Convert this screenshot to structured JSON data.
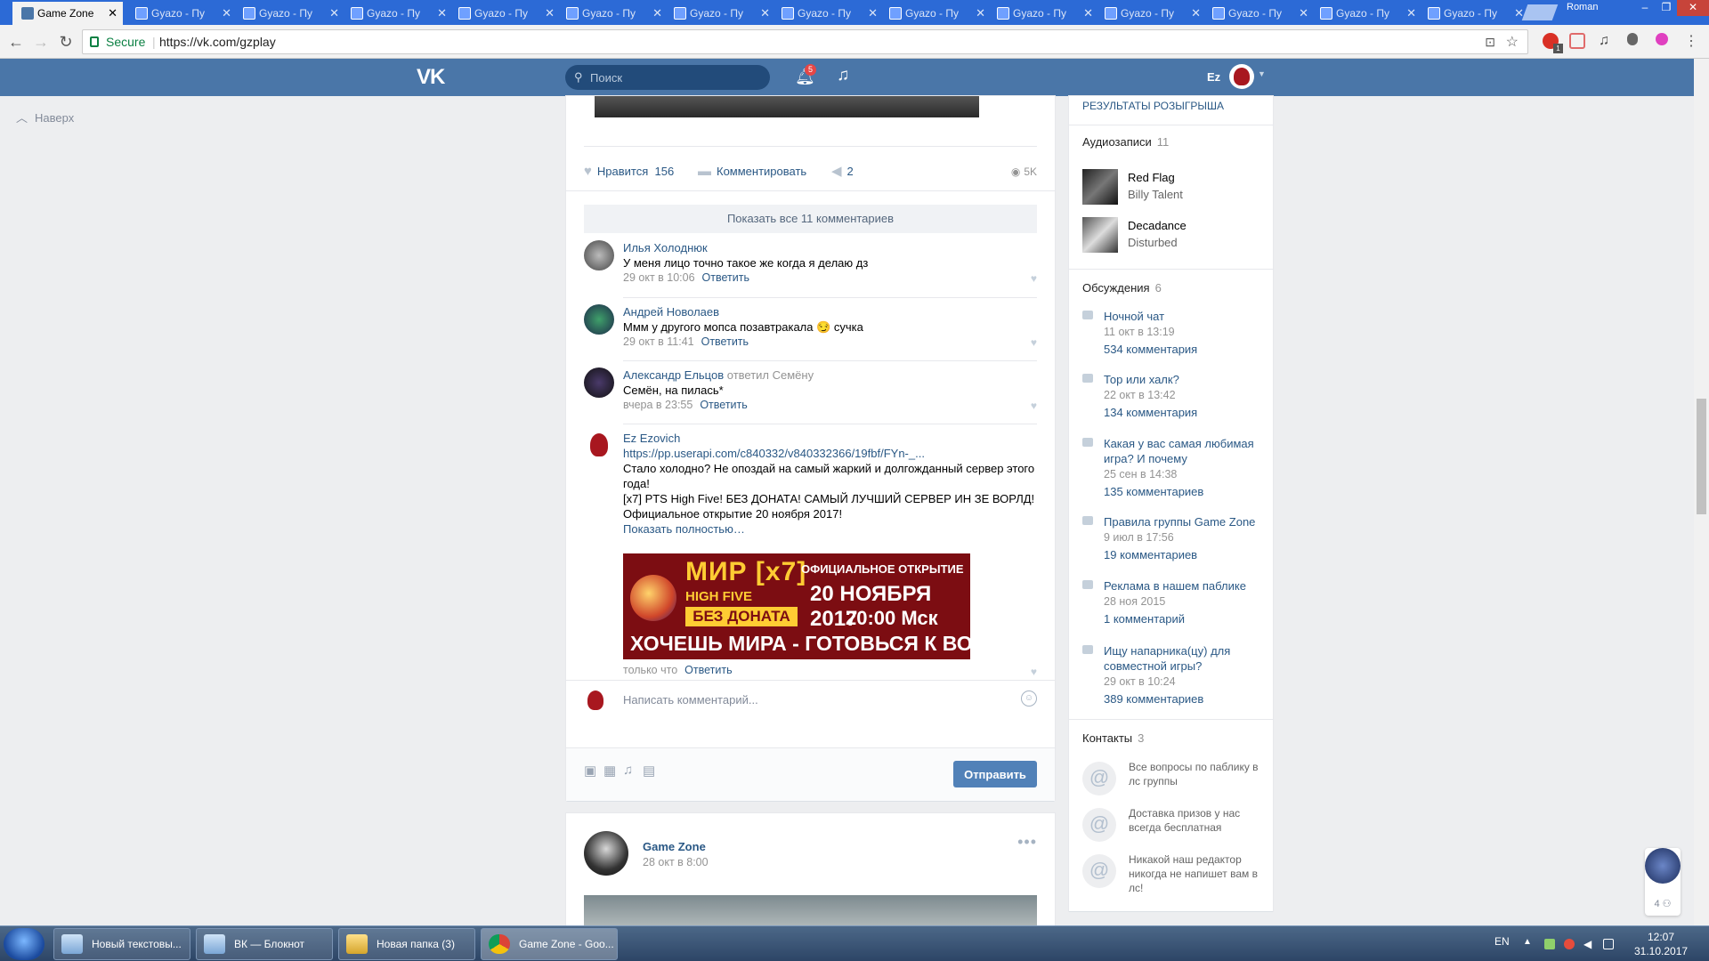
{
  "browser": {
    "tabs": [
      {
        "title": "Game Zone",
        "kind": "vk"
      },
      {
        "title": "Gyazo - Пу",
        "kind": "gyazo"
      },
      {
        "title": "Gyazo - Пу",
        "kind": "gyazo"
      },
      {
        "title": "Gyazo - Пу",
        "kind": "gyazo"
      },
      {
        "title": "Gyazo - Пу",
        "kind": "gyazo"
      },
      {
        "title": "Gyazo - Пу",
        "kind": "gyazo"
      },
      {
        "title": "Gyazo - Пу",
        "kind": "gyazo"
      },
      {
        "title": "Gyazo - Пу",
        "kind": "gyazo"
      },
      {
        "title": "Gyazo - Пу",
        "kind": "gyazo"
      },
      {
        "title": "Gyazo - Пу",
        "kind": "gyazo"
      },
      {
        "title": "Gyazo - Пу",
        "kind": "gyazo"
      },
      {
        "title": "Gyazo - Пу",
        "kind": "gyazo"
      },
      {
        "title": "Gyazo - Пу",
        "kind": "gyazo"
      },
      {
        "title": "Gyazo - Пу",
        "kind": "gyazo"
      }
    ],
    "profile_name": "Roman",
    "secure_label": "Secure",
    "url": "https://vk.com/gzplay",
    "adblock_count": "1"
  },
  "vk_header": {
    "logo": "VK",
    "search_placeholder": "Поиск",
    "notifications_count": "5",
    "user_short": "Ez"
  },
  "left": {
    "back_to_top": "Наверх"
  },
  "post1": {
    "actions": {
      "like_label": "Нравится",
      "like_count": "156",
      "comment_label": "Комментировать",
      "share_count": "2",
      "views": "5K"
    },
    "show_all_comments": "Показать все 11 комментариев",
    "comments": [
      {
        "author": "Илья Холоднюк",
        "reply_to": "",
        "text": "У меня лицо точно такое же когда я делаю дз",
        "time": "29 окт в 10:06",
        "reply": "Ответить"
      },
      {
        "author": "Андрей Новолаев",
        "reply_to": "",
        "text": "Ммм у другого мопса позавтракала 😏 сучка",
        "time": "29 окт в 11:41",
        "reply": "Ответить"
      },
      {
        "author": "Александр Ельцов",
        "reply_to": "ответил Семёну",
        "text": "Семён, на пилась*",
        "time": "вчера в 23:55",
        "reply": "Ответить"
      }
    ],
    "my_comment": {
      "author": "Ez Ezovich",
      "link": "https://pp.userapi.com/c840332/v840332366/19fbf/FYn-_...",
      "line1": "Стало холодно? Не опоздай на самый жаркий и долгожданный сервер этого года!",
      "line2": "[x7] PTS High Five! БЕЗ ДОНАТА! САМЫЙ ЛУЧШИЙ СЕРВЕР ИН ЗЕ ВОРЛД!",
      "line3": "Официальное открытие 20 ноября 2017!",
      "show_more": "Показать полностью…",
      "time": "только что",
      "reply": "Ответить",
      "banner": {
        "mir": "МИР",
        "x7": "[x7]",
        "official": "ОФИЦИАЛЬНОЕ ОТКРЫТИЕ",
        "highfive": "HIGH FIVE",
        "date": "20 НОЯБРЯ 2017",
        "nodonate": "БЕЗ ДОНАТА",
        "time": "20:00 Мск",
        "slogan": "ХОЧЕШЬ МИРА - ГОТОВЬСЯ К ВОЙНЕ"
      }
    },
    "write_placeholder": "Написать комментарий...",
    "send_button": "Отправить"
  },
  "post2": {
    "author": "Game Zone",
    "date": "28 окт в 8:00"
  },
  "sidebar": {
    "giveaway_results": "РЕЗУЛЬТАТЫ РОЗЫГРЫША",
    "audio_title": "Аудиозаписи",
    "audio_count": "11",
    "audio": [
      {
        "name": "Red Flag",
        "artist": "Billy Talent"
      },
      {
        "name": "Decadance",
        "artist": "Disturbed"
      }
    ],
    "discussions_title": "Обсуждения",
    "discussions_count": "6",
    "discussions": [
      {
        "title": "Ночной чат",
        "date": "11 окт в 13:19",
        "comments": "534 комментария"
      },
      {
        "title": "Тор или халк?",
        "date": "22 окт в 13:42",
        "comments": "134 комментария"
      },
      {
        "title": "Какая у вас самая любимая игра? И почему",
        "date": "25 сен в 14:38",
        "comments": "135 комментариев"
      },
      {
        "title": "Правила группы Game Zone",
        "date": "9 июл в 17:56",
        "comments": "19 комментариев"
      },
      {
        "title": "Реклама в нашем паблике",
        "date": "28 ноя 2015",
        "comments": "1 комментарий"
      },
      {
        "title": "Ищу напарника(цу) для совместной игры?",
        "date": "29 окт в 10:24",
        "comments": "389 комментариев"
      }
    ],
    "contacts_title": "Контакты",
    "contacts_count": "3",
    "contacts": [
      {
        "text": "Все вопросы по паблику в лс группы"
      },
      {
        "text": "Доставка призов у нас всегда бесплатная"
      },
      {
        "text": "Никакой наш редактор никогда не напишет вам в лс!"
      }
    ]
  },
  "chat_widget": {
    "count": "4"
  },
  "taskbar": {
    "items": [
      {
        "label": "Новый текстовы..."
      },
      {
        "label": "ВК — Блокнот"
      },
      {
        "label": "Новая папка (3)"
      },
      {
        "label": "Game Zone - Goo..."
      }
    ],
    "lang": "EN",
    "time": "12:07",
    "date": "31.10.2017"
  }
}
